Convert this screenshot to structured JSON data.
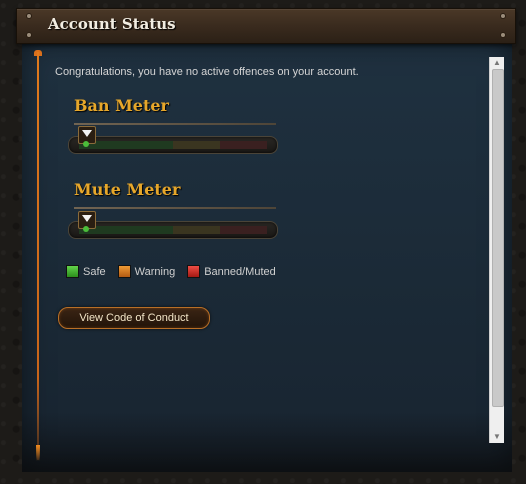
{
  "window": {
    "title": "Account Status"
  },
  "message": "Congratulations, you have no active offences on your account.",
  "meters": [
    {
      "title": "Ban Meter",
      "level": 0
    },
    {
      "title": "Mute Meter",
      "level": 0
    }
  ],
  "legend": [
    {
      "label": "Safe",
      "color": "#3cbf2a"
    },
    {
      "label": "Warning",
      "color": "#e08224"
    },
    {
      "label": "Banned/Muted",
      "color": "#d5322c"
    }
  ],
  "actions": {
    "view_code_of_conduct": "View Code of Conduct"
  },
  "scrollbar": {
    "up_icon": "triangle-up",
    "down_icon": "triangle-down"
  }
}
